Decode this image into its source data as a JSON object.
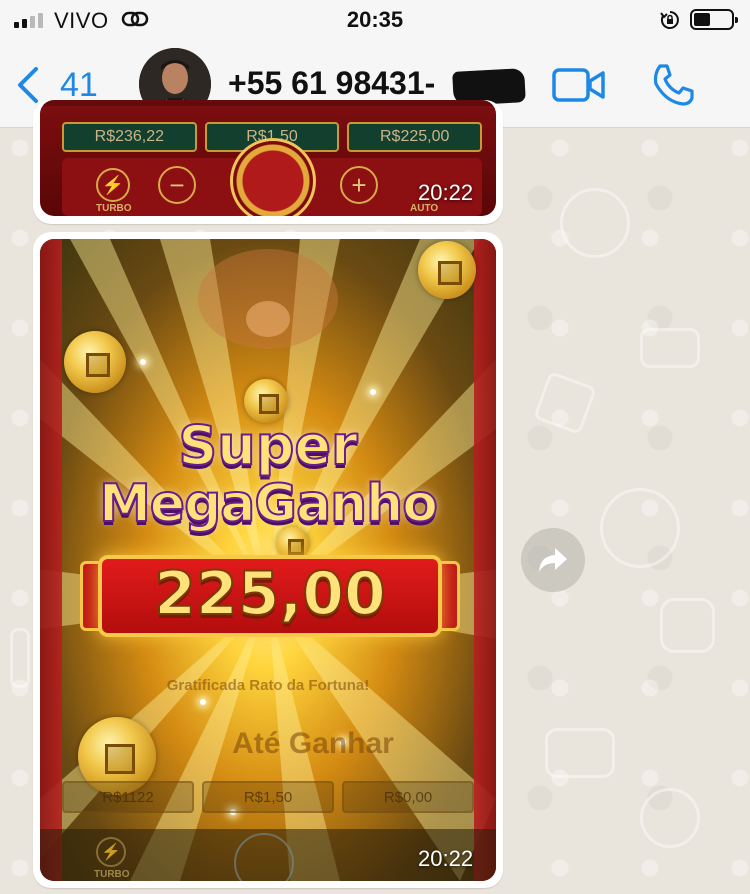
{
  "status_bar": {
    "carrier": "VIVO",
    "time": "20:35"
  },
  "header": {
    "back_count": "41",
    "contact_name": "+55 61 98431-",
    "icons": [
      "chevron-left-icon",
      "video-call-icon",
      "phone-call-icon"
    ]
  },
  "messages": [
    {
      "type": "image",
      "time": "20:22",
      "game": {
        "values": [
          "R$236,22",
          "R$1,50",
          "R$225,00"
        ],
        "controls": {
          "left_label": "TURBO",
          "right_label": "AUTO"
        }
      }
    },
    {
      "type": "image",
      "time": "20:22",
      "game": {
        "title_line1": "Super",
        "title_line2": "MegaGanho",
        "amount": "225,00",
        "subtitle": "Gratificada Rato da Fortuna!",
        "faded_banner": "Até Ganhar",
        "values": [
          "R$1122",
          "R$1,50",
          "R$0,00"
        ],
        "controls": {
          "left_label": "TURBO"
        }
      }
    }
  ],
  "colors": {
    "accent": "#1e88e5",
    "header_bg": "#f6f6f6",
    "chat_bg": "#e9e4dc",
    "bubble_bg": "#ffffff"
  }
}
